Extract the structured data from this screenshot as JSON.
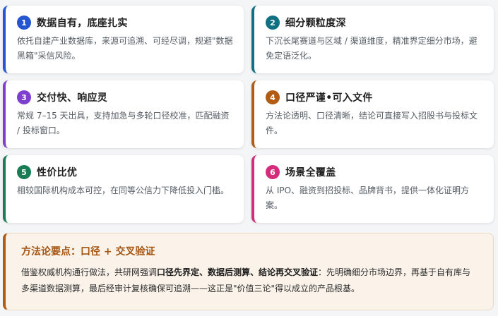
{
  "colors": {
    "blue": "#2456d1",
    "teal": "#0f7182",
    "purple": "#7e3fcf",
    "orange": "#b25b12",
    "green": "#187c55",
    "pink": "#d42b7a"
  },
  "cards": [
    {
      "num": "1",
      "title": "数据自有，底座扎实",
      "desc": "依托自建产业数据库，来源可追溯、可经尽调，规避\"数据黑箱\"采信风险。"
    },
    {
      "num": "2",
      "title": "细分颗粒度深",
      "desc": "下沉长尾赛道与区域 / 渠道维度，精准界定细分市场，避免定语泛化。"
    },
    {
      "num": "3",
      "title": "交付快、响应灵",
      "desc": "常规 7–15 天出具，支持加急与多轮口径校准，匹配融资 / 投标窗口。"
    },
    {
      "num": "4",
      "title": "口径严谨•可入文件",
      "desc": "方法论透明、口径清晰，结论可直接写入招股书与投标文件。"
    },
    {
      "num": "5",
      "title": "性价比优",
      "desc": "相较国际机构成本可控，在同等公信力下降低投入门槛。"
    },
    {
      "num": "6",
      "title": "场景全覆盖",
      "desc": "从 IPO、融资到招投标、品牌背书，提供一体化证明方案。"
    }
  ],
  "method": {
    "title": "方法论要点：口径 + 交叉验证",
    "text_before": "借鉴权威机构通行做法，共研网强调",
    "text_bold": "口径先界定、数据后测算、结论再交叉验证",
    "text_after": "：先明确细分市场边界，再基于自有库与多渠道数据测算，最后经审计复核确保可追溯——这正是\"价值三论\"得以成立的产品根基。"
  }
}
